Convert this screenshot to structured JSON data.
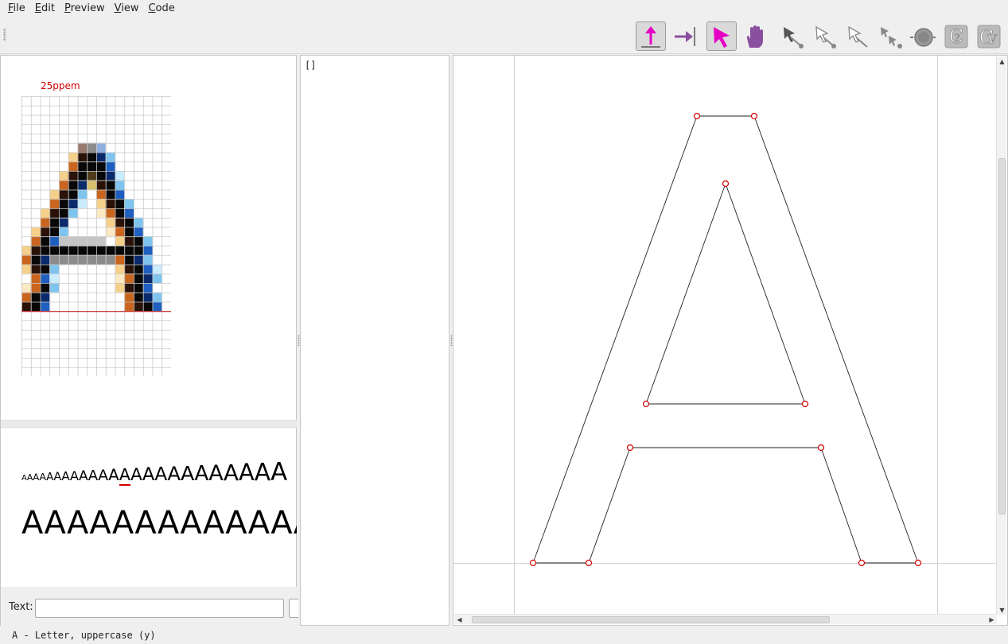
{
  "menu": {
    "file": {
      "mnemonic": "F",
      "rest": "ile"
    },
    "edit": {
      "mnemonic": "E",
      "rest": "dit"
    },
    "preview": {
      "mnemonic": "P",
      "rest": "review"
    },
    "view": {
      "mnemonic": "V",
      "rest": "iew"
    },
    "code": {
      "mnemonic": "C",
      "rest": "ode"
    }
  },
  "toolbar": {
    "tools": [
      {
        "icon": "move-up-arrow-icon",
        "active": true
      },
      {
        "icon": "move-right-arrow-icon",
        "active": false
      },
      {
        "icon": "pointer-arrow-icon",
        "active": true
      },
      {
        "icon": "hand-pan-icon",
        "active": false
      },
      {
        "icon": "link-tool-icon",
        "active": false
      },
      {
        "icon": "shift-tool-icon",
        "active": false
      },
      {
        "icon": "align-tool-icon",
        "active": false
      },
      {
        "icon": "interpolate-tool-icon",
        "active": false
      },
      {
        "icon": "round-tool-icon",
        "active": false
      },
      {
        "icon": "cvt-control-icon",
        "active": false
      },
      {
        "icon": "cvt-value-icon",
        "active": false
      }
    ],
    "colors": {
      "accent": "#e600c3",
      "accent_purple": "#8a4f9e"
    }
  },
  "preview": {
    "ppem_label": "25ppem",
    "grid": {
      "cols": 16,
      "rows": 30,
      "baseline_row": 23
    },
    "waterfall_glyph": "A",
    "waterfall_count": 24,
    "current_index": 12,
    "big_text": "AAAAAAAAAAAAAAA",
    "text_label": "Text:",
    "text_value": ""
  },
  "code": {
    "content": "[]"
  },
  "glyph": {
    "point_color": "#d40000",
    "outline_color": "#222222"
  },
  "status": {
    "text": "A - Letter, uppercase (y)"
  }
}
